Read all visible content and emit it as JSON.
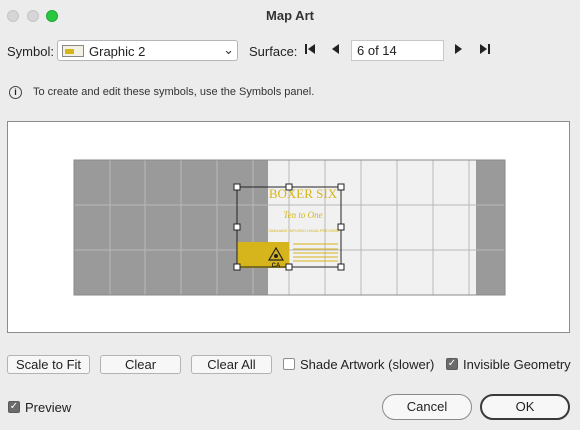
{
  "window": {
    "title": "Map Art"
  },
  "symbol": {
    "label": "Symbol:",
    "value": "Graphic 2"
  },
  "surface": {
    "label": "Surface:",
    "value": "6 of 14"
  },
  "info_text": "To create and edit these symbols, use the Symbols panel.",
  "artwork": {
    "brand": "BOXER SIX",
    "tagline": "Ten to One",
    "small_line": "CANNABIS INFUSED HAND-PRESSED",
    "badge": "CA",
    "colors": {
      "gold": "#d6b51c",
      "gray": "#999999",
      "light": "#f1f1f1"
    }
  },
  "buttons": {
    "scale_to_fit": "Scale to Fit",
    "clear": "Clear",
    "clear_all": "Clear All",
    "cancel": "Cancel",
    "ok": "OK"
  },
  "checkboxes": {
    "shade_artwork": {
      "label": "Shade Artwork (slower)",
      "checked": false
    },
    "invisible_geometry": {
      "label": "Invisible Geometry",
      "checked": true
    },
    "preview": {
      "label": "Preview",
      "checked": true
    }
  }
}
